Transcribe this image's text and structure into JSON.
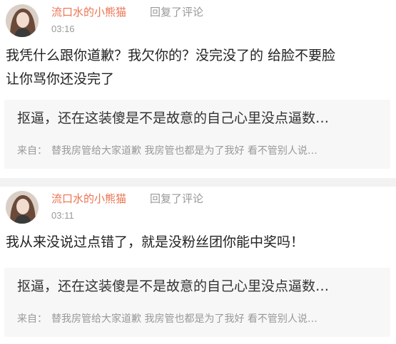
{
  "comments": [
    {
      "username": "流口水的小熊猫",
      "action": "回复了评论",
      "time": "03:16",
      "text_line1": "我凭什么跟你道歉？我欠你的？没完没了的 给脸不要脸",
      "text_line2": "让你骂你还没完了",
      "quote": {
        "text": "抠逼，还在这装傻是不是故意的自己心里没点逼数…",
        "source_label": "来自：",
        "source_text": "替我房管给大家道歉 我房管也都是为了我好 看不管别人说…"
      }
    },
    {
      "username": "流口水的小熊猫",
      "action": "回复了评论",
      "time": "03:11",
      "text_line1": "我从来没说过点错了，就是没粉丝团你能中奖吗！",
      "quote": {
        "text": "抠逼，还在这装傻是不是故意的自己心里没点逼数…",
        "source_label": "来自：",
        "source_text": "替我房管给大家道歉 我房管也都是为了我好 看不管别人说…"
      }
    }
  ],
  "colors": {
    "username": "#eb7350",
    "muted": "#999999",
    "quote_bg": "#f7f7f7",
    "separator": "#f2f2f2"
  }
}
